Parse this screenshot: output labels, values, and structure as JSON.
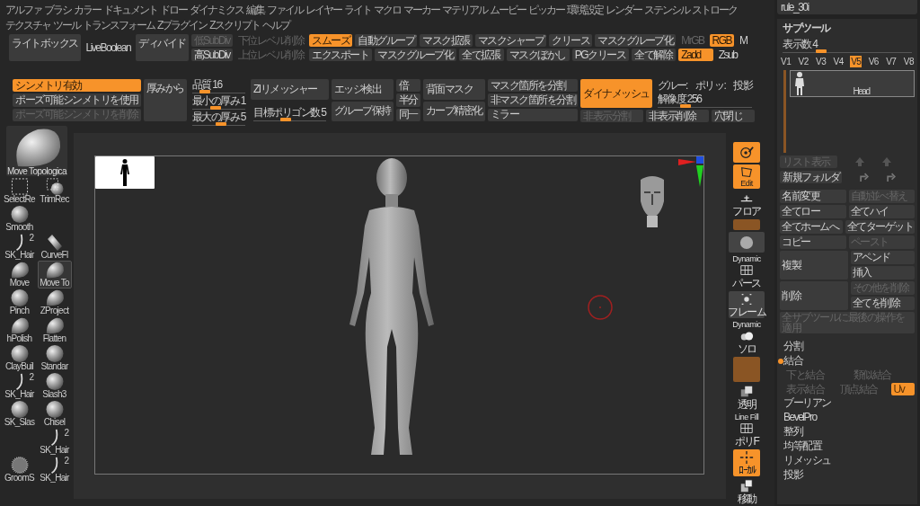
{
  "menu_rows": [
    {
      "items": [
        "アルファ",
        "ブラシ",
        "カラー",
        "ドキュメント",
        "ドロー",
        "ダイナミクス",
        "編集",
        "ファイル",
        "レイヤー",
        "ライト",
        "マクロ",
        "マーカー",
        "マテリアル",
        "ムービー",
        "ピッカー",
        "環境設定",
        "レンダー",
        "ステンシル",
        "ストローク"
      ]
    },
    {
      "items": [
        "テクスチャ",
        "ツール",
        "トランスフォーム",
        "Zプラグイン",
        "Zスクリプト",
        "ヘルプ"
      ]
    }
  ],
  "toolbar_top": [
    {
      "kind": "button",
      "label": "ライトボックス",
      "active": false,
      "disabled": false
    },
    {
      "kind": "text",
      "label": "LiveBoolean"
    },
    {
      "kind": "button",
      "label": "ディバイド",
      "active": false,
      "disabled": false
    },
    {
      "kind": "rows",
      "rows": [
        [
          {
            "kind": "button",
            "label": "低SubDiv",
            "active": false,
            "disabled": true
          }
        ],
        [
          {
            "kind": "button",
            "label": "高SubDiv",
            "active": false,
            "disabled": false
          }
        ]
      ]
    },
    {
      "kind": "rows",
      "rows": [
        [
          {
            "kind": "text",
            "label": "下位レベル削除",
            "disabled": true
          }
        ],
        [
          {
            "kind": "text",
            "label": "上位レベル削除",
            "disabled": true
          }
        ]
      ]
    },
    {
      "kind": "rows",
      "rows": [
        [
          {
            "kind": "button",
            "label": "スムーズ",
            "active": true,
            "disabled": false
          },
          {
            "kind": "button",
            "label": "自動グループ",
            "active": false,
            "disabled": false
          },
          {
            "kind": "button",
            "label": "マスク拡張",
            "active": false,
            "disabled": false
          },
          {
            "kind": "button",
            "label": "マスクシャープ",
            "active": false,
            "disabled": false
          },
          {
            "kind": "button",
            "label": "クリース",
            "active": false,
            "disabled": false
          },
          {
            "kind": "button",
            "label": "マスクグループ化",
            "active": false,
            "disabled": false
          }
        ],
        [
          {
            "kind": "button",
            "label": "エクスポート",
            "active": false,
            "disabled": false
          },
          {
            "kind": "button",
            "label": "マスクグループ化",
            "active": false,
            "disabled": false
          },
          {
            "kind": "button",
            "label": "全て拡張",
            "active": false,
            "disabled": false
          },
          {
            "kind": "button",
            "label": "マスクぼかし",
            "active": false,
            "disabled": false
          },
          {
            "kind": "button",
            "label": "PGクリース",
            "active": false,
            "disabled": false
          },
          {
            "kind": "button",
            "label": "全て解除",
            "active": false,
            "disabled": false
          }
        ]
      ]
    },
    {
      "kind": "rows",
      "rows": [
        [
          {
            "kind": "text",
            "label": "MrGB",
            "disabled": true
          },
          {
            "kind": "button",
            "label": "RGB",
            "active": true,
            "disabled": false
          },
          {
            "kind": "text",
            "label": "M",
            "disabled": false
          }
        ],
        [
          {
            "kind": "button",
            "label": "Zadd",
            "active": true,
            "disabled": false
          },
          {
            "kind": "text",
            "label": "Zsub",
            "disabled": false
          }
        ]
      ]
    }
  ],
  "toolbar_bottom": [
    {
      "kind": "rows",
      "rows": [
        [
          {
            "kind": "button",
            "label": "シンメトリ有効",
            "active": true,
            "disabled": false
          }
        ],
        [
          {
            "kind": "button",
            "label": "ポーズ可能シンメトリを使用",
            "active": false,
            "disabled": false
          }
        ],
        [
          {
            "kind": "button",
            "label": "ポーズ可能シンメトリを削除",
            "active": false,
            "disabled": true
          }
        ]
      ]
    },
    {
      "kind": "button",
      "label": "厚みから",
      "active": false,
      "disabled": false
    },
    {
      "kind": "rows",
      "rows": [
        [
          {
            "kind": "slider",
            "label": "品質 16",
            "level": 0.25
          }
        ],
        [
          {
            "kind": "slider",
            "label": "最小の厚み 1",
            "level": 0.45
          }
        ],
        [
          {
            "kind": "slider",
            "label": "最大の厚み 5",
            "level": 0.55
          }
        ]
      ]
    },
    {
      "kind": "rows",
      "rows": [
        [
          {
            "kind": "button",
            "label": "ZIリメッシャー",
            "active": false,
            "disabled": false
          }
        ],
        [
          {
            "kind": "slider",
            "label": "目標ポリゴン数 5",
            "level": 0.45
          }
        ]
      ]
    },
    {
      "kind": "rows",
      "rows": [
        [
          {
            "kind": "button",
            "label": "エッジ検出",
            "active": false,
            "disabled": false
          }
        ],
        [
          {
            "kind": "button",
            "label": "グループ保持",
            "active": false,
            "disabled": false
          }
        ]
      ]
    },
    {
      "kind": "rows",
      "rows": [
        [
          {
            "kind": "button",
            "label": "倍",
            "active": false,
            "disabled": false
          }
        ],
        [
          {
            "kind": "button",
            "label": "半分",
            "active": false,
            "disabled": false
          }
        ],
        [
          {
            "kind": "button",
            "label": "同一",
            "active": false,
            "disabled": false
          }
        ]
      ]
    },
    {
      "kind": "rows",
      "rows": [
        [
          {
            "kind": "button",
            "label": "背面マスク",
            "active": false,
            "disabled": false
          }
        ],
        [
          {
            "kind": "button",
            "label": "カーブ精密化",
            "active": false,
            "disabled": false
          }
        ]
      ]
    },
    {
      "kind": "rows",
      "rows": [
        [
          {
            "kind": "button",
            "label": "マスク箇所を分割",
            "active": false,
            "disabled": false
          }
        ],
        [
          {
            "kind": "button",
            "label": "非マスク箇所を分割",
            "active": false,
            "disabled": false
          }
        ],
        [
          {
            "kind": "button",
            "label": "ミラー",
            "active": false,
            "disabled": false
          }
        ]
      ]
    },
    {
      "kind": "rows",
      "rows": [
        [
          {
            "kind": "button",
            "label": "ダイナメッシュ",
            "active": true,
            "disabled": false
          },
          {
            "kind": "rows",
            "rows": [
              [
                {
                  "kind": "text",
                  "label": "グルー:",
                  "disabled": false
                },
                {
                  "kind": "text",
                  "label": "ポリッ:",
                  "disabled": false
                },
                {
                  "kind": "text",
                  "label": "投影",
                  "disabled": false
                }
              ],
              [
                {
                  "kind": "slider",
                  "label": "解像度 256",
                  "level": 0.3
                }
              ]
            ]
          }
        ],
        [
          {
            "kind": "button",
            "label": "非表示分割",
            "active": false,
            "disabled": true
          },
          {
            "kind": "button",
            "label": "非表示削除",
            "active": false,
            "disabled": false
          },
          {
            "kind": "button",
            "label": "穴閉じ",
            "active": false,
            "disabled": false
          }
        ]
      ]
    }
  ],
  "current_brush": {
    "label": "Move Topologica"
  },
  "brush_rows": [
    {
      "left": {
        "label": "SelectRe",
        "kind": "marquee",
        "selected": false
      },
      "right": {
        "label": "TrimRec",
        "kind": "trim",
        "selected": false
      }
    },
    {
      "left": {
        "label": "Smooth",
        "kind": "sphere",
        "selected": false
      }
    },
    {
      "left": {
        "label": "SK_Hair",
        "kind": "hair",
        "badge": "2",
        "selected": false
      },
      "right": {
        "label": "CurveFl",
        "kind": "tube",
        "selected": false
      }
    },
    {
      "left": {
        "label": "Move",
        "kind": "blob",
        "selected": false
      },
      "right": {
        "label": "Move To",
        "kind": "blob",
        "selected": true
      }
    },
    {
      "left": {
        "label": "Pinch",
        "kind": "sphere",
        "selected": false
      },
      "right": {
        "label": "ZProject",
        "kind": "blob",
        "selected": false
      }
    },
    {
      "left": {
        "label": "hPolish",
        "kind": "blob",
        "selected": false
      },
      "right": {
        "label": "Flatten",
        "kind": "blob",
        "selected": false
      }
    },
    {
      "left": {
        "label": "ClayBuil",
        "kind": "sphere",
        "selected": false
      },
      "right": {
        "label": "Standar",
        "kind": "sphere",
        "selected": false
      }
    },
    {
      "left": {
        "label": "SK_Hair",
        "kind": "hair",
        "badge": "2",
        "selected": false
      },
      "right": {
        "label": "Slash3",
        "kind": "sphere",
        "selected": false
      }
    },
    {
      "left": {
        "label": "SK_Slas",
        "kind": "sphere",
        "selected": false
      },
      "right": {
        "label": "Chisel",
        "kind": "sphere",
        "selected": false
      }
    },
    {
      "right": {
        "label": "SK_Hair",
        "kind": "hair",
        "badge": "2",
        "selected": false
      }
    },
    {
      "left": {
        "label": "GroomS",
        "kind": "groom",
        "selected": false
      },
      "right": {
        "label": "SK_Hair",
        "kind": "hair",
        "badge": "2",
        "selected": false
      }
    }
  ],
  "view_tools": [
    {
      "kind": "target",
      "active": true,
      "disabled": false
    },
    {
      "kind": "quad",
      "active": true,
      "disabled": false,
      "label": "Edit"
    },
    {
      "kind": "floor",
      "active": false,
      "disabled": false,
      "label": "フロア"
    },
    {
      "kind": "blank",
      "active": true,
      "disabled": true
    },
    {
      "kind": "sphere",
      "active": false,
      "disabled": false
    },
    {
      "kind": "grid",
      "active": false,
      "disabled": false,
      "top": "Dynamic",
      "label": "パース"
    },
    {
      "kind": "dots",
      "active": false,
      "disabled": false,
      "label": "フレーム"
    },
    {
      "kind": "cloud",
      "active": false,
      "disabled": false,
      "top": "Dynamic",
      "label": "ソロ"
    },
    {
      "kind": "blank",
      "active": true,
      "disabled": true
    },
    {
      "kind": "squares",
      "active": false,
      "disabled": false,
      "label": "透明"
    },
    {
      "kind": "grid",
      "active": false,
      "disabled": false,
      "top": "Line Fill",
      "label": "ポリF"
    },
    {
      "kind": "cross",
      "active": true,
      "disabled": false,
      "label": "ﾛｰｶﾙ"
    },
    {
      "kind": "box",
      "active": false,
      "disabled": false,
      "label": "移動"
    }
  ],
  "subtool": {
    "path": "rule_30i",
    "title": "サブツール",
    "count": {
      "kind": "slider",
      "label": "表示数 4",
      "level": 0.3
    },
    "versions": [
      {
        "label": "V1",
        "selected": false
      },
      {
        "label": "V2",
        "selected": false
      },
      {
        "label": "V3",
        "selected": false
      },
      {
        "label": "V4",
        "selected": false
      },
      {
        "label": "V5",
        "selected": true
      },
      {
        "label": "V6",
        "selected": false
      },
      {
        "label": "V7",
        "selected": false
      },
      {
        "label": "V8",
        "selected": false
      }
    ],
    "items": [
      {
        "name": "Head",
        "selected": true
      }
    ],
    "list_buttons": [
      {
        "label": "リスト表示",
        "disabled": true
      },
      {
        "label": "新規フォルダ",
        "disabled": false
      }
    ],
    "actions": [
      {
        "kind": "rows",
        "rows": [
          [
            {
              "kind": "button",
              "label": "名前変更",
              "active": false,
              "disabled": false
            },
            {
              "kind": "button",
              "label": "自動並べ替え",
              "active": false,
              "disabled": true
            }
          ]
        ]
      },
      {
        "kind": "rows",
        "rows": [
          [
            {
              "kind": "button",
              "label": "全てロー",
              "active": false,
              "disabled": false
            },
            {
              "kind": "button",
              "label": "全てハイ",
              "active": false,
              "disabled": false
            }
          ]
        ]
      },
      {
        "kind": "rows",
        "rows": [
          [
            {
              "kind": "button",
              "label": "全てホームへ",
              "active": false,
              "disabled": false
            },
            {
              "kind": "button",
              "label": "全てターゲット",
              "active": false,
              "disabled": false
            }
          ]
        ]
      },
      {
        "kind": "rows",
        "rows": [
          [
            {
              "kind": "button",
              "label": "コピー",
              "active": false,
              "disabled": false
            },
            {
              "kind": "button",
              "label": "ペースト",
              "active": false,
              "disabled": true
            }
          ]
        ]
      },
      {
        "kind": "rows",
        "rows": [
          [
            {
              "kind": "button",
              "label": "複製",
              "active": false,
              "disabled": false
            },
            {
              "kind": "rows",
              "rows": [
                [
                  {
                    "kind": "button",
                    "label": "アペンド",
                    "active": false,
                    "disabled": false
                  }
                ],
                [
                  {
                    "kind": "button",
                    "label": "挿入",
                    "active": false,
                    "disabled": false
                  }
                ]
              ]
            }
          ]
        ]
      },
      {
        "kind": "rows",
        "rows": [
          [
            {
              "kind": "button",
              "label": "削除",
              "active": false,
              "disabled": false
            },
            {
              "kind": "rows",
              "rows": [
                [
                  {
                    "kind": "button",
                    "label": "その他を削除",
                    "active": false,
                    "disabled": true
                  }
                ],
                [
                  {
                    "kind": "button",
                    "label": "全てを削除",
                    "active": false,
                    "disabled": false
                  }
                ]
              ]
            }
          ]
        ]
      },
      {
        "kind": "rows",
        "rows": [
          [
            {
              "kind": "button",
              "label": "全サブツールに最後の操作を適用",
              "active": false,
              "disabled": true
            }
          ]
        ]
      }
    ],
    "menu": [
      {
        "kind": "entry",
        "label": "分割",
        "expanded": false
      },
      {
        "kind": "entry",
        "label": "結合",
        "expanded": true
      },
      {
        "kind": "rows",
        "rows": [
          [
            {
              "kind": "text",
              "label": "下と結合",
              "disabled": true
            },
            {
              "kind": "text",
              "label": "類似結合",
              "disabled": true
            }
          ],
          [
            {
              "kind": "text",
              "label": "表示結合",
              "disabled": true
            },
            {
              "kind": "text",
              "label": "頂点結合",
              "disabled": true
            },
            {
              "kind": "button",
              "label": "Uv",
              "active": true,
              "disabled": true
            }
          ]
        ]
      },
      {
        "kind": "entry",
        "label": "ブーリアン",
        "expanded": false
      },
      {
        "kind": "entry",
        "label": "BevelPro",
        "expanded": false
      },
      {
        "kind": "entry",
        "label": "整列",
        "expanded": false
      },
      {
        "kind": "entry",
        "label": "均等配置",
        "expanded": false
      },
      {
        "kind": "entry",
        "label": "リメッシュ",
        "expanded": false
      },
      {
        "kind": "entry",
        "label": "投影",
        "expanded": false
      }
    ]
  }
}
